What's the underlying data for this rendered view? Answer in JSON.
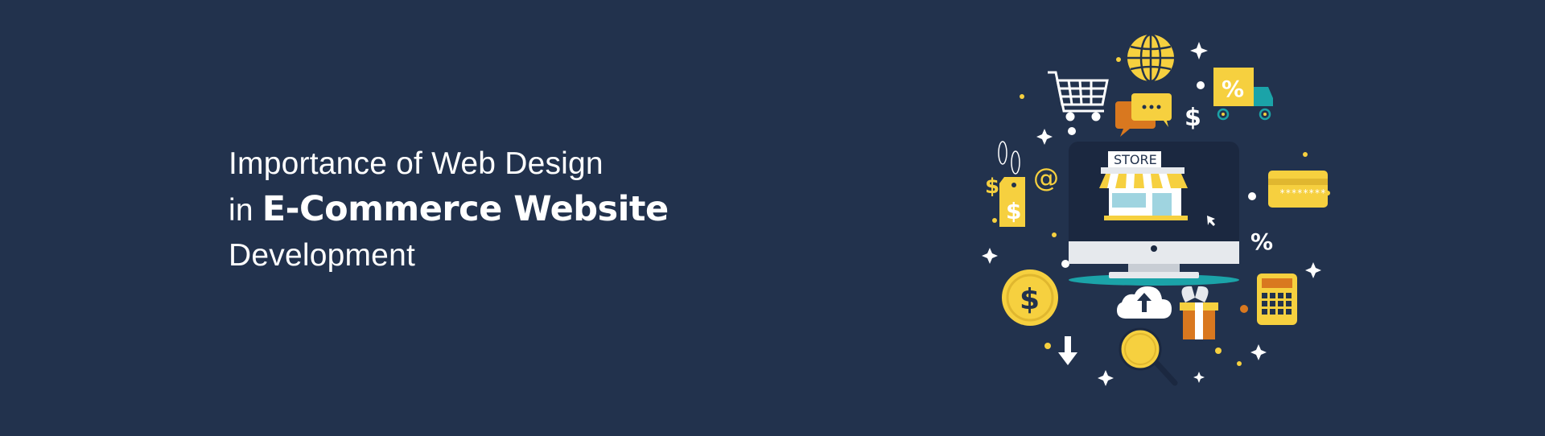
{
  "banner": {
    "line1": "Importance of Web Design",
    "line2_prefix": "in ",
    "line2_bold": "E-Commerce Website",
    "line3": "Development"
  },
  "illustration": {
    "store_sign": "STORE",
    "dollar": "$",
    "percent": "%",
    "at": "@",
    "card_digits": "********",
    "icons": [
      "globe-icon",
      "shopping-cart-icon",
      "chat-bubble-icon",
      "delivery-truck-icon",
      "price-tag-icon",
      "monitor-icon",
      "storefront-icon",
      "credit-card-icon",
      "dollar-coin-icon",
      "cloud-upload-icon",
      "gift-box-icon",
      "calculator-icon",
      "magnifier-icon",
      "download-arrow-icon"
    ]
  },
  "colors": {
    "background": "#22324d",
    "yellow": "#f6d03f",
    "orange": "#d9781f",
    "teal": "#1ba3a8",
    "white": "#ffffff"
  }
}
